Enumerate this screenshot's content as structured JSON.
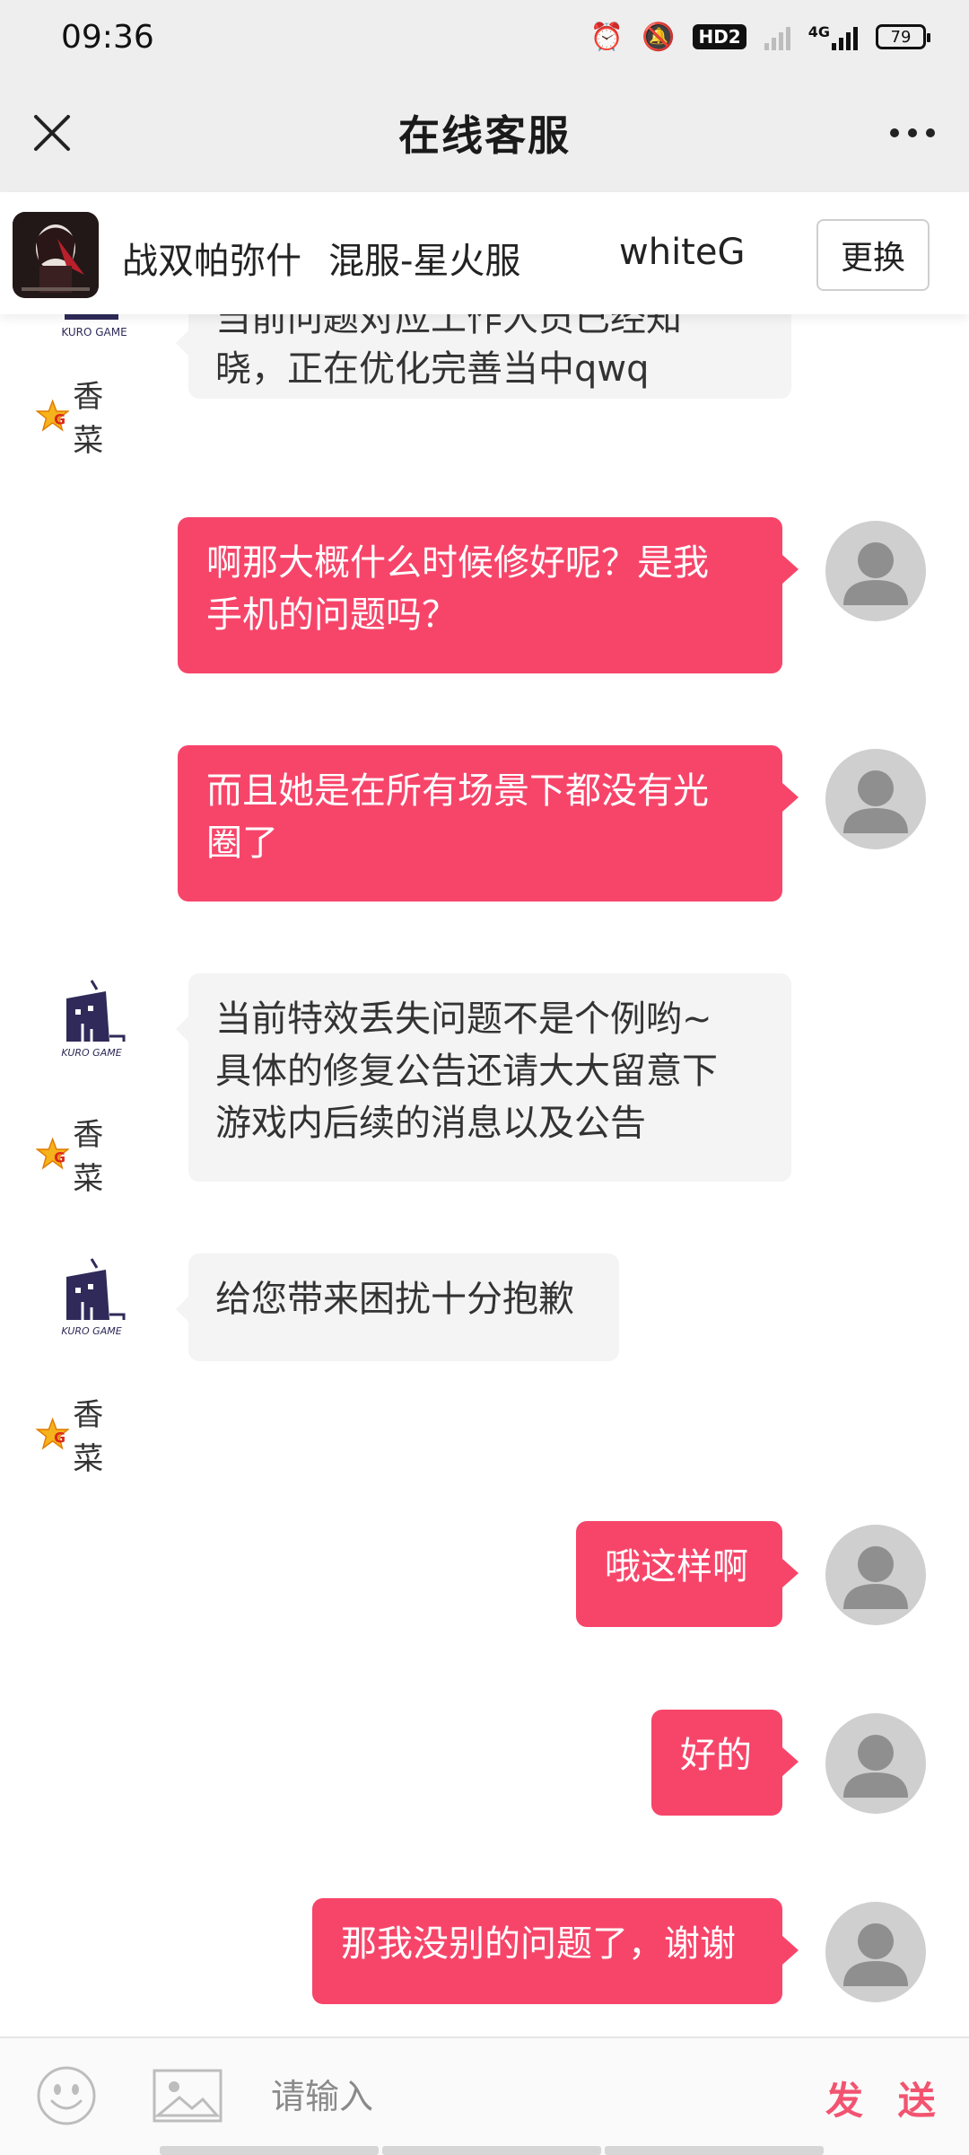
{
  "status_bar": {
    "time": "09:36",
    "network": "4G",
    "hd_label": "HD2",
    "battery": "79"
  },
  "header": {
    "title": "在线客服"
  },
  "game_bar": {
    "game": "战双帕弥什",
    "server": "混服-星火服",
    "role": "whiteG",
    "change_label": "更换"
  },
  "agent": {
    "name": "香菜",
    "logo_text": "KURO GAME"
  },
  "messages": [
    {
      "from": "agent",
      "text_lines": [
        "当前问题对应工作人员已经知",
        "晓，正在优化完善当中qwq"
      ]
    },
    {
      "from": "user",
      "text_lines": [
        "啊那大概什么时候修好呢？是我",
        "手机的问题吗？"
      ]
    },
    {
      "from": "user",
      "text_lines": [
        "而且她是在所有场景下都没有光",
        "圈了"
      ]
    },
    {
      "from": "agent",
      "text_lines": [
        "当前特效丢失问题不是个例哟~",
        "具体的修复公告还请大大留意下",
        "游戏内后续的消息以及公告"
      ]
    },
    {
      "from": "agent",
      "text_lines": [
        "给您带来困扰十分抱歉"
      ]
    },
    {
      "from": "user",
      "text_lines": [
        "哦这样啊"
      ]
    },
    {
      "from": "user",
      "text_lines": [
        "好的"
      ]
    },
    {
      "from": "user",
      "text_lines": [
        "那我没别的问题了，谢谢"
      ]
    }
  ],
  "input": {
    "placeholder": "请输入",
    "value": "",
    "send_label": "发 送"
  },
  "colors": {
    "accent": "#f7456a",
    "send_text": "#f25470",
    "header_bg": "#eeeeee",
    "agent_bubble": "#f4f4f4"
  }
}
